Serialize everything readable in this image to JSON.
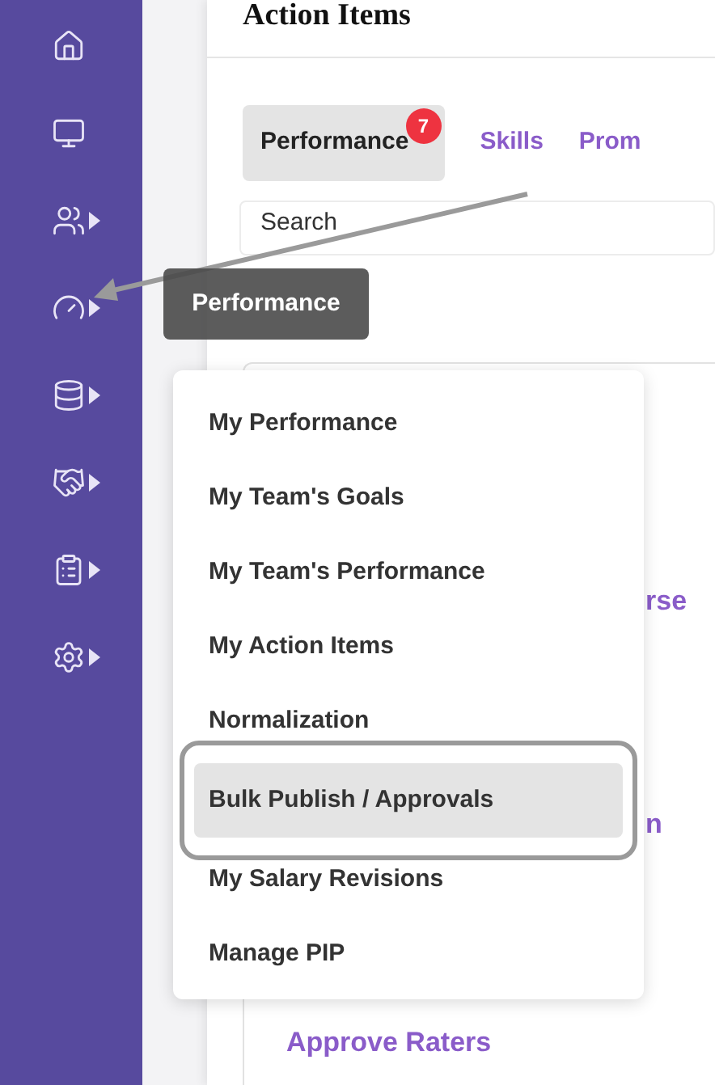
{
  "sidebar": {
    "items": [
      {
        "kind": "home",
        "has_submenu": false
      },
      {
        "kind": "monitor",
        "has_submenu": false
      },
      {
        "kind": "users",
        "has_submenu": true
      },
      {
        "kind": "gauge",
        "has_submenu": true
      },
      {
        "kind": "database",
        "has_submenu": true
      },
      {
        "kind": "handshake",
        "has_submenu": true
      },
      {
        "kind": "clipboard",
        "has_submenu": true
      },
      {
        "kind": "settings",
        "has_submenu": true
      }
    ]
  },
  "header": {
    "title": "Action Items"
  },
  "tabs": [
    {
      "label": "Performance",
      "selected": true,
      "badge": "7"
    },
    {
      "label": "Skills",
      "selected": false
    },
    {
      "label": "Prom",
      "selected": false
    }
  ],
  "search": {
    "placeholder": "Search"
  },
  "links": [
    "rse",
    "n",
    "Approve Raters"
  ],
  "tooltip": {
    "text": "Performance"
  },
  "menu": {
    "items": [
      {
        "label": "My Performance",
        "selected": false
      },
      {
        "label": "My Team's Goals",
        "selected": false
      },
      {
        "label": "My Team's Performance",
        "selected": false
      },
      {
        "label": "My Action Items",
        "selected": false
      },
      {
        "label": "Normalization",
        "selected": false
      },
      {
        "label": "Bulk Publish / Approvals",
        "selected": true
      },
      {
        "label": "My Salary Revisions",
        "selected": false
      },
      {
        "label": "Manage PIP",
        "selected": false
      }
    ]
  }
}
